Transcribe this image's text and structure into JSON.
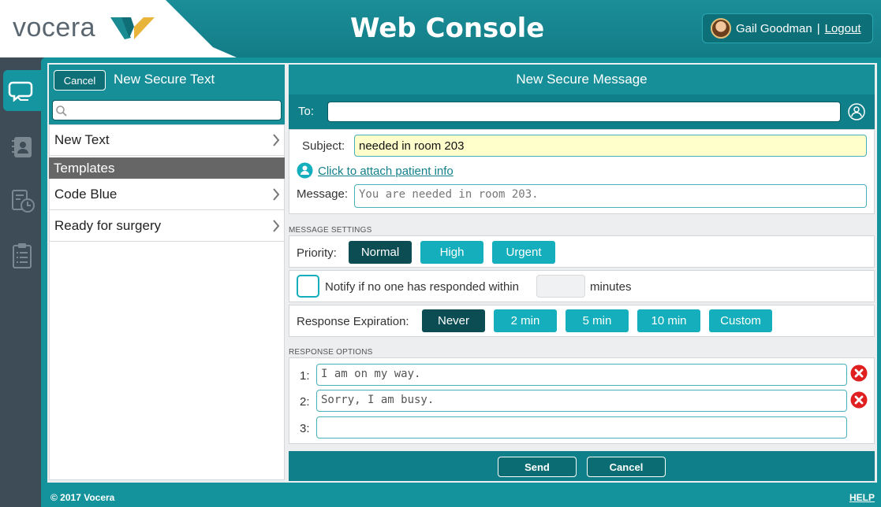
{
  "header": {
    "logo_text": "vocera",
    "title": "Web Console",
    "user_name": "Gail Goodman",
    "separator": "|",
    "logout_label": "Logout"
  },
  "rail": {
    "items": [
      {
        "icon": "chat-bubbles-icon",
        "active": true
      },
      {
        "icon": "contacts-book-icon",
        "active": false
      },
      {
        "icon": "history-clock-icon",
        "active": false
      },
      {
        "icon": "clipboard-checklist-icon",
        "active": false
      }
    ]
  },
  "left_panel": {
    "cancel_label": "Cancel",
    "title": "New Secure Text",
    "search_placeholder": "",
    "new_text_label": "New Text",
    "templates_header": "Templates",
    "templates": [
      "Code Blue",
      "Ready for surgery"
    ]
  },
  "right_panel": {
    "title": "New Secure Message",
    "to_label": "To:",
    "to_value": "",
    "subject_label": "Subject:",
    "subject_value": "needed in room 203",
    "attach_label": "Click to attach patient info",
    "message_label": "Message:",
    "message_value": "You are needed in room 203."
  },
  "settings": {
    "section_label": "MESSAGE SETTINGS",
    "priority_label": "Priority:",
    "priority_options": [
      "Normal",
      "High",
      "Urgent"
    ],
    "priority_selected": "Normal",
    "notify_prefix": "Notify if no one has responded within",
    "notify_suffix": "minutes",
    "notify_minutes": "",
    "notify_checked": false,
    "expiration_label": "Response Expiration:",
    "expiration_options": [
      "Never",
      "2 min",
      "5 min",
      "10 min",
      "Custom"
    ],
    "expiration_selected": "Never"
  },
  "response_options": {
    "section_label": "RESPONSE OPTIONS",
    "items": [
      {
        "num": "1:",
        "value": "I am on my way."
      },
      {
        "num": "2:",
        "value": "Sorry, I am busy."
      },
      {
        "num": "3:",
        "value": ""
      }
    ]
  },
  "footer": {
    "send_label": "Send",
    "cancel_label": "Cancel",
    "copyright": "© 2017 Vocera",
    "help_label": "HELP"
  },
  "colors": {
    "teal": "#178f99",
    "teal_dark": "#0f7f89",
    "button_cyan": "#14aebc",
    "button_selected": "#0b4d52",
    "delete_red": "#e02020",
    "subject_highlight": "#ffffcc"
  }
}
